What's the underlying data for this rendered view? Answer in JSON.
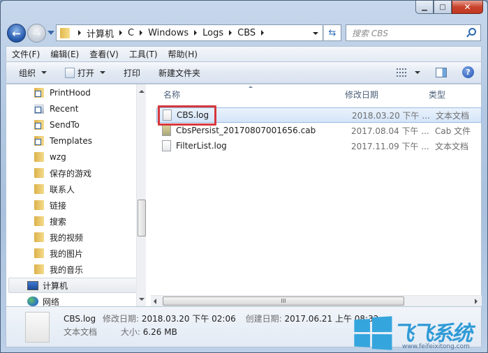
{
  "window": {
    "caption_buttons": {
      "minimize": "▁",
      "maximize": "□",
      "close": "✕"
    }
  },
  "nav": {
    "back_icon": "back-arrow-icon",
    "forward_icon": "forward-arrow-icon",
    "back_glyph": "←",
    "forward_glyph": "→"
  },
  "address": {
    "crumbs": [
      "计算机",
      "C",
      "Windows",
      "Logs",
      "CBS"
    ],
    "refresh_glyph": "⇆"
  },
  "search": {
    "placeholder": "搜索 CBS"
  },
  "menubar": {
    "items": [
      "文件(F)",
      "编辑(E)",
      "查看(V)",
      "工具(T)",
      "帮助(H)"
    ]
  },
  "toolbar": {
    "organize": "组织",
    "open": "打开",
    "print": "打印",
    "new_folder": "新建文件夹",
    "help_glyph": "?"
  },
  "sidebar": {
    "items": [
      {
        "label": "PrintHood",
        "icon": "folder-shortcut-icon"
      },
      {
        "label": "Recent",
        "icon": "recent-shortcut-icon"
      },
      {
        "label": "SendTo",
        "icon": "folder-shortcut-icon"
      },
      {
        "label": "Templates",
        "icon": "folder-shortcut-icon"
      },
      {
        "label": "wzg",
        "icon": "folder-icon"
      },
      {
        "label": "保存的游戏",
        "icon": "saved-games-folder-icon"
      },
      {
        "label": "联系人",
        "icon": "contacts-folder-icon"
      },
      {
        "label": "链接",
        "icon": "links-folder-icon"
      },
      {
        "label": "搜索",
        "icon": "searches-folder-icon"
      },
      {
        "label": "我的视频",
        "icon": "videos-folder-icon"
      },
      {
        "label": "我的图片",
        "icon": "pictures-folder-icon"
      },
      {
        "label": "我的音乐",
        "icon": "music-folder-icon"
      },
      {
        "label": "计算机",
        "icon": "computer-icon",
        "selected": true
      },
      {
        "label": "网络",
        "icon": "network-icon"
      }
    ]
  },
  "files": {
    "columns": [
      "名称",
      "修改日期",
      "类型"
    ],
    "rows": [
      {
        "name": "CBS.log",
        "date": "2018.03.20 下午 ...",
        "type": "文本文档",
        "selected": true
      },
      {
        "name": "CbsPersist_20170807001656.cab",
        "date": "2017.08.04 下午 ...",
        "type": "Cab 文件"
      },
      {
        "name": "FilterList.log",
        "date": "2017.11.09 下午 ...",
        "type": "文本文档"
      }
    ],
    "hscroll_grip": "III"
  },
  "details": {
    "name": "CBS.log",
    "type": "文本文档",
    "modified_label": "修改日期:",
    "modified_value": "2018.03.20 下午 02:06",
    "created_label": "创建日期:",
    "created_value": "2017.06.21 上午 08:32",
    "size_label": "大小:",
    "size_value": "6.26 MB"
  },
  "watermark": {
    "text": "飞飞系统",
    "url": "www.feifeixitong.com"
  },
  "colors": {
    "highlight_box": "#d6383c",
    "selection_bg": "#d4e5f9",
    "accent_blue": "#2f6fb5"
  }
}
